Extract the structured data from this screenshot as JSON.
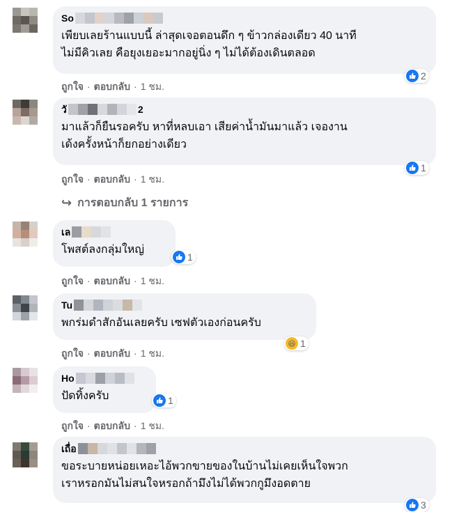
{
  "actions": {
    "like": "ถูกใจ",
    "reply": "ตอบกลับ",
    "dot": "·",
    "time": "1 ชม."
  },
  "replies_link": {
    "label": "การตอบกลับ 1 รายการ"
  },
  "comments": [
    {
      "name": "So",
      "lines": [
        "เพียบเลยร้านแบบนี้ ล่าสุดเจอตอนดึก ๆ ข้าวกล่องเดียว 40 นาที",
        "ไม่มีคิวเลย คือยุงเยอะมากอยู่นิ่ง ๆ ไม่ได้ต้องเดินตลอด"
      ],
      "reaction": "like",
      "count": "2"
    },
    {
      "name": "วั",
      "name_suffix": "2",
      "lines": [
        "มาแล้วก็ยืนรอครับ หาที่หลบเอา เสียค่าน้ำมันมาแล้ว เจองาน",
        "เด้งครั้งหน้าก็ยกอย่างเดียว"
      ],
      "reaction": "like",
      "count": "1"
    },
    {
      "name": "เล",
      "lines": [
        "โพสต์ลงกลุ่มใหญ่"
      ],
      "reaction": "like",
      "count": "1"
    },
    {
      "name": "Tu",
      "lines": [
        "พกร่มดำสักอันเลยครับ เซฟตัวเองก่อนครับ"
      ],
      "reaction": "haha",
      "count": "1"
    },
    {
      "name": "Ho",
      "lines": [
        "ปัดทิ้งครับ"
      ],
      "reaction": "like",
      "count": "1"
    },
    {
      "name": "เถื่อ",
      "lines": [
        "ขอระบายหน่อยเหอะไอ้พวกขายของในบ้านไม่เคยเห็นใจพวก",
        "เราหรอกมันไม่สนใจหรอกถ้ามึงไม่ได้พวกกูมึงอดตาย"
      ],
      "reaction": "like",
      "count": "3"
    }
  ],
  "colors": {
    "bubble": "#f0f2f5",
    "like": "#1877f2",
    "meta": "#65676b"
  }
}
